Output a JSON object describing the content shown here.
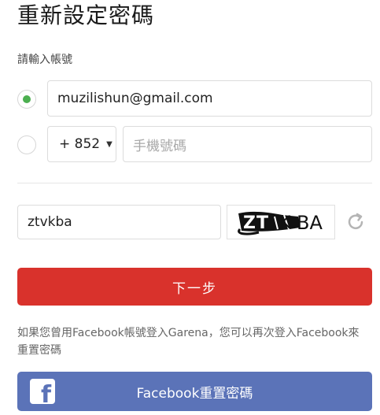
{
  "page": {
    "title": "重新設定密碼",
    "section_label": "請輸入帳號"
  },
  "email_option": {
    "selected": true,
    "value": "muzilishun@gmail.com"
  },
  "phone_option": {
    "selected": false,
    "country_code": "+ 852",
    "placeholder": "手機號碼"
  },
  "captcha": {
    "input_value": "ztvkba",
    "image_text": "ZTVKBA"
  },
  "actions": {
    "next_label": "下一步",
    "facebook_hint": "如果您曾用Facebook帳號登入Garena，您可以再次登入Facebook來重置密碼",
    "facebook_reset_label": "Facebook重置密碼"
  },
  "colors": {
    "accent_red": "#d9322c",
    "facebook_blue": "#5b73b8",
    "radio_green": "#4caf50"
  },
  "icons": {
    "refresh": "refresh-icon",
    "facebook": "facebook-logo-icon",
    "dropdown": "caret-down-icon"
  }
}
